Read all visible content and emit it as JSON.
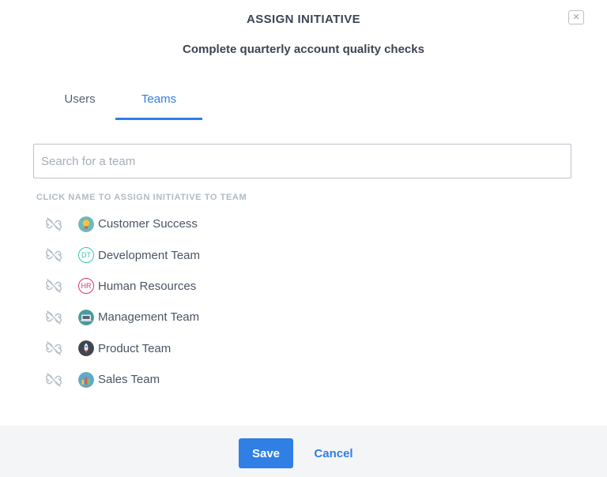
{
  "modal": {
    "title": "ASSIGN INITIATIVE",
    "close_glyph": "✕",
    "subtitle": "Complete quarterly account quality checks"
  },
  "tabs": [
    {
      "label": "Users",
      "active": false
    },
    {
      "label": "Teams",
      "active": true
    }
  ],
  "search": {
    "value": "",
    "placeholder": "Search for a team"
  },
  "hint": "CLICK NAME TO ASSIGN INITIATIVE TO TEAM",
  "teams": [
    {
      "name": "Customer Success",
      "avatar": "lightbulb-avatar"
    },
    {
      "name": "Development Team",
      "avatar": "initials",
      "initials": "DT",
      "color": "#3cc3b4"
    },
    {
      "name": "Human Resources",
      "avatar": "initials",
      "initials": "HR",
      "color": "#d63a6e"
    },
    {
      "name": "Management Team",
      "avatar": "laptop-avatar"
    },
    {
      "name": "Product Team",
      "avatar": "rocket-avatar"
    },
    {
      "name": "Sales Team",
      "avatar": "chart-avatar"
    }
  ],
  "footer": {
    "save_label": "Save",
    "cancel_label": "Cancel"
  },
  "colors": {
    "accent": "#2f7fe4",
    "text": "#4a5563",
    "footer_bg": "#f4f5f6"
  }
}
